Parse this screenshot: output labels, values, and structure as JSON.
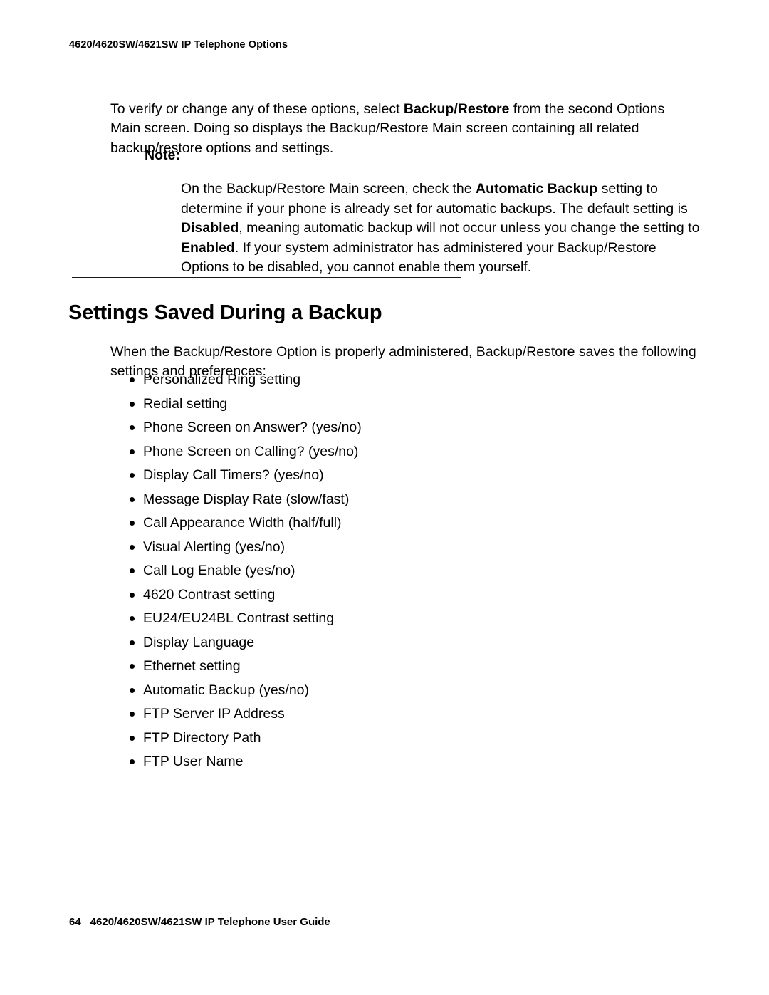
{
  "page": {
    "background_color": "#ffffff",
    "text_color": "#000000"
  },
  "header": {
    "running_title": "4620/4620SW/4621SW IP Telephone Options"
  },
  "intro": {
    "segments": [
      {
        "text": "To verify or change any of these options, select ",
        "bold": false
      },
      {
        "text": "Backup/Restore",
        "bold": true
      },
      {
        "text": " from the second Options Main screen. Doing so displays the Backup/Restore Main screen containing all related backup/restore options and settings.",
        "bold": false
      }
    ]
  },
  "note": {
    "label": "Note:",
    "segments": [
      {
        "text": "On the Backup/Restore Main screen, check the ",
        "bold": false
      },
      {
        "text": "Automatic Backup",
        "bold": true
      },
      {
        "text": " setting to determine if your phone is already set for automatic backups. The default setting is ",
        "bold": false
      },
      {
        "text": "Disabled",
        "bold": true
      },
      {
        "text": ", meaning automatic backup will not occur unless you change the setting to ",
        "bold": false
      },
      {
        "text": "Enabled",
        "bold": true
      },
      {
        "text": ". If your system administrator has administered your Backup/Restore Options to be disabled, you cannot enable them yourself.",
        "bold": false
      }
    ]
  },
  "section": {
    "heading": "Settings Saved During a Backup",
    "lead_paragraph": "When the Backup/Restore Option is properly administered, Backup/Restore saves the following settings and preferences:",
    "bullets": [
      "Personalized Ring setting",
      "Redial setting",
      "Phone Screen on Answer? (yes/no)",
      "Phone Screen on Calling? (yes/no)",
      "Display Call Timers? (yes/no)",
      "Message Display Rate (slow/fast)",
      "Call Appearance Width (half/full)",
      "Visual Alerting (yes/no)",
      "Call Log Enable (yes/no)",
      "4620 Contrast setting",
      "EU24/EU24BL Contrast setting",
      "Display Language",
      "Ethernet setting",
      "Automatic Backup (yes/no)",
      "FTP Server IP Address",
      "FTP Directory Path",
      "FTP User Name"
    ]
  },
  "footer": {
    "page_number": "64",
    "document_title": "4620/4620SW/4621SW IP Telephone User Guide"
  }
}
